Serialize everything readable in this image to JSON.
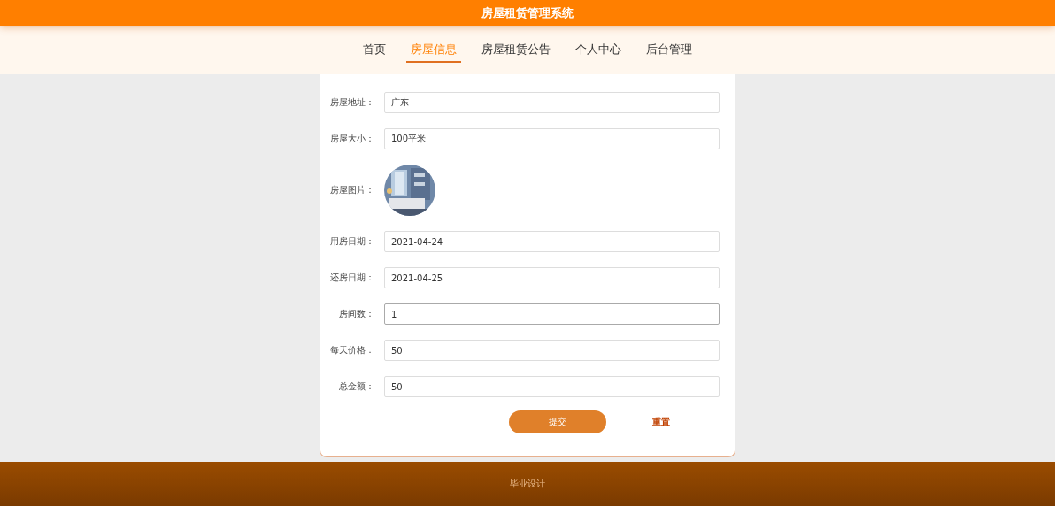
{
  "header": {
    "title": "房屋租赁管理系统"
  },
  "nav": [
    {
      "label": "首页",
      "selected": false
    },
    {
      "label": "房屋信息",
      "selected": true
    },
    {
      "label": "房屋租赁公告",
      "selected": false
    },
    {
      "label": "个人中心",
      "selected": false
    },
    {
      "label": "后台管理",
      "selected": false
    }
  ],
  "form": {
    "fields": [
      {
        "kind": "text",
        "label": "房屋地址：",
        "value": "广东",
        "focused": false
      },
      {
        "kind": "text",
        "label": "房屋大小：",
        "value": "100平米",
        "focused": false
      },
      {
        "label": "房屋图片："
      },
      {
        "kind": "text",
        "label": "用房日期：",
        "value": "2021-04-24",
        "focused": false
      },
      {
        "kind": "text",
        "label": "还房日期：",
        "value": "2021-04-25",
        "focused": false
      },
      {
        "kind": "text",
        "label": "房间数：",
        "value": "1",
        "focused": true
      },
      {
        "kind": "text",
        "label": "每天价格：",
        "value": "50",
        "focused": false
      },
      {
        "kind": "text",
        "label": "总金额：",
        "value": "50",
        "focused": false
      }
    ],
    "submit": "提交",
    "reset": "重置"
  },
  "footer": {
    "text": "毕业设计"
  }
}
